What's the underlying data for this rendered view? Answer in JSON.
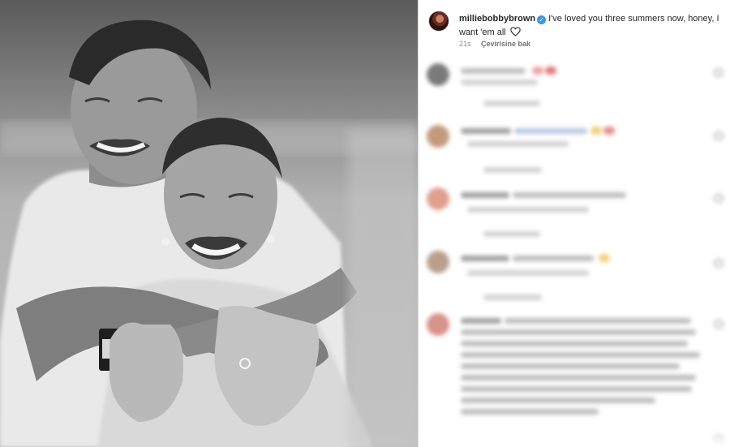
{
  "post": {
    "username": "milliebobbybrown",
    "caption": "I've loved you three summers now, honey, I want 'em all",
    "time_ago": "21s",
    "translate_label": "Çevirisine bak"
  },
  "colors": {
    "verified_badge": "#3897f0",
    "meta_text": "#8e8e8e",
    "divider": "#dbdbdb"
  }
}
